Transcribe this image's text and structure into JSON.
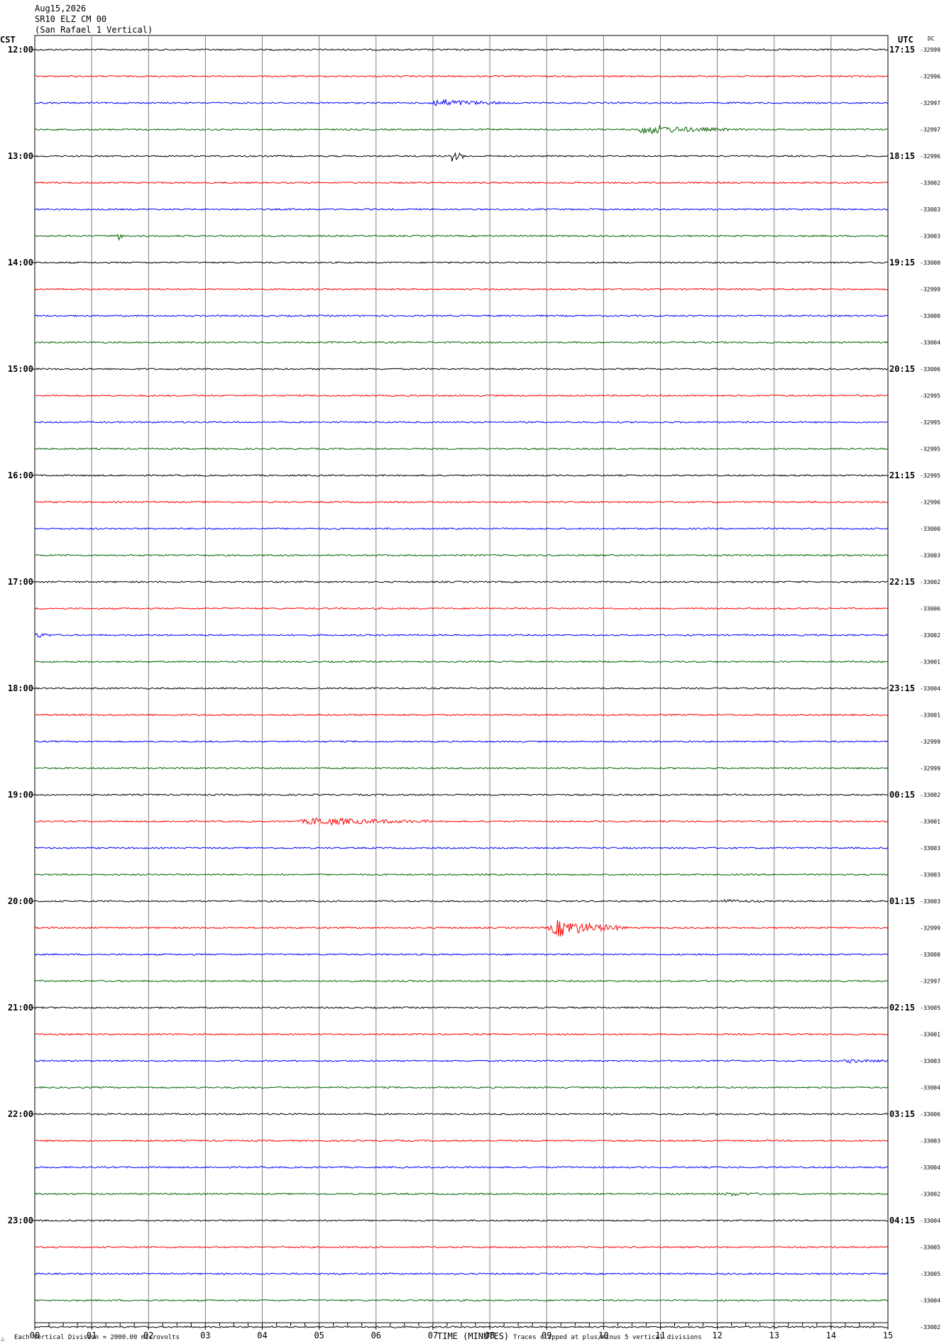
{
  "header": {
    "date": "Aug15,2026",
    "station": "SR10 ELZ CM 00",
    "site": "(San Rafael 1 Vertical)"
  },
  "left_axis_title": "CST",
  "right_axis_title": "UTC",
  "dc_title": "DC",
  "footer": {
    "scale_note": "Each Vertical Division = 2000.00 microvolts",
    "xlabel": "TIME (MINUTES)",
    "clip_note": "Traces clipped at plus/minus 5 vertical divisions",
    "corner_mark": "∴"
  },
  "chart_data": {
    "type": "line",
    "title": "",
    "xlabel": "TIME (MINUTES)",
    "xlim": [
      0,
      15
    ],
    "x_ticks": [
      "00",
      "01",
      "02",
      "03",
      "04",
      "05",
      "06",
      "07",
      "08",
      "09",
      "10",
      "11",
      "12",
      "13",
      "14",
      "15"
    ],
    "trace_colors": [
      "#000000",
      "#ff0000",
      "#0000ff",
      "#006400"
    ],
    "left_labels": [
      "12:00",
      "13:00",
      "14:00",
      "15:00",
      "16:00",
      "17:00",
      "18:00",
      "19:00",
      "20:00",
      "21:00",
      "22:00",
      "23:00"
    ],
    "right_labels": [
      "17:15",
      "18:15",
      "19:15",
      "20:15",
      "21:15",
      "22:15",
      "23:15",
      "00:15",
      "01:15",
      "02:15",
      "03:15",
      "04:15"
    ],
    "dc_offsets": [
      "-32999",
      "-32996",
      "-32997",
      "-32997",
      "-32996",
      "-33002",
      "-33003",
      "-33003",
      "-33000",
      "-32999",
      "-33000",
      "-33004",
      "-33006",
      "-32995",
      "-32995",
      "-32995",
      "-32995",
      "-32996",
      "-33000",
      "-33003",
      "-33002",
      "-33006",
      "-33002",
      "-33001",
      "-33004",
      "-33001",
      "-32999",
      "-32999",
      "-33002",
      "-33001",
      "-33003",
      "-33003",
      "-33003",
      "-32999",
      "-33000",
      "-32997",
      "-33005",
      "-33001",
      "-33003",
      "-33004",
      "-33006",
      "-33003",
      "-33004",
      "-33002",
      "-33004",
      "-33005",
      "-33005",
      "-33004",
      "-33002"
    ],
    "events": [
      {
        "trace": 2,
        "start_min": 6.9,
        "end_min": 8.2,
        "amplitude": 5
      },
      {
        "trace": 3,
        "start_min": 10.5,
        "end_min": 12.2,
        "amplitude": 6
      },
      {
        "trace": 4,
        "start_min": 7.3,
        "end_min": 7.6,
        "amplitude": 8
      },
      {
        "trace": 7,
        "start_min": 1.45,
        "end_min": 1.6,
        "amplitude": 6
      },
      {
        "trace": 22,
        "start_min": 0.0,
        "end_min": 0.35,
        "amplitude": 3
      },
      {
        "trace": 29,
        "start_min": 4.6,
        "end_min": 7.0,
        "amplitude": 5
      },
      {
        "trace": 32,
        "start_min": 12.0,
        "end_min": 12.8,
        "amplitude": 2
      },
      {
        "trace": 33,
        "start_min": 9.0,
        "end_min": 10.4,
        "amplitude": 12
      },
      {
        "trace": 38,
        "start_min": 14.2,
        "end_min": 15.0,
        "amplitude": 2
      },
      {
        "trace": 43,
        "start_min": 12.1,
        "end_min": 12.9,
        "amplitude": 2
      }
    ]
  }
}
